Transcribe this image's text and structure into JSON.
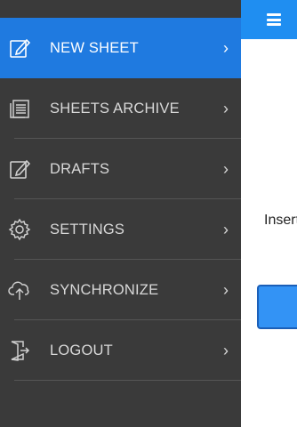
{
  "sidebar": {
    "items": [
      {
        "label": "NEW SHEET",
        "icon": "edit-sheet-icon",
        "active": true
      },
      {
        "label": "SHEETS ARCHIVE",
        "icon": "archive-list-icon",
        "active": false
      },
      {
        "label": "DRAFTS",
        "icon": "drafts-edit-icon",
        "active": false
      },
      {
        "label": "SETTINGS",
        "icon": "gear-icon",
        "active": false
      },
      {
        "label": "SYNCHRONIZE",
        "icon": "cloud-sync-icon",
        "active": false
      },
      {
        "label": "LOGOUT",
        "icon": "logout-door-icon",
        "active": false
      }
    ],
    "chevron": "›"
  },
  "main": {
    "body_text": "Insert"
  },
  "colors": {
    "sidebar_bg": "#3a3a3a",
    "active_bg": "#1f7ae0",
    "header_bg": "#1f8ef1",
    "button_bg": "#3393f5"
  }
}
